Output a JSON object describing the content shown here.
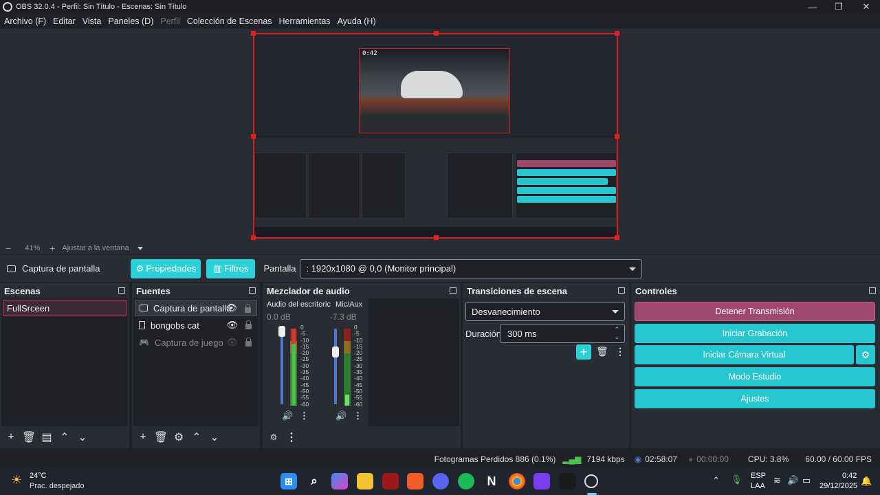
{
  "window": {
    "title": "OBS 32.0.4 - Perfil: Sin Título - Escenas: Sin Título",
    "minimize": "—",
    "maximize": "❐",
    "close": "✕"
  },
  "menu": [
    "Archivo (F)",
    "Editar",
    "Vista",
    "Paneles (D)",
    "Perfil",
    "Colección de Escenas",
    "Herramientas",
    "Ayuda (H)"
  ],
  "preview": {
    "time": "0:42",
    "zoom": "41%",
    "fit_label": "Ajustar a la ventana"
  },
  "source_bar": {
    "source_name": "Captura de pantalla",
    "properties_label": "Propiedades",
    "filters_label": "Filtros",
    "screen_label": "Pantalla",
    "screen_value": ": 1920x1080 @ 0,0 (Monitor principal)"
  },
  "scenes": {
    "title": "Escenas",
    "items": [
      "FullSrceen"
    ]
  },
  "sources": {
    "title": "Fuentes",
    "items": [
      {
        "label": "Captura de pantalla",
        "icon": "monitor-icon",
        "visible": true
      },
      {
        "label": "bongobs cat",
        "icon": "file-icon",
        "visible": true
      },
      {
        "label": "Captura de juego",
        "icon": "gamepad-icon",
        "visible": false
      }
    ]
  },
  "mixer": {
    "title": "Mezclador de audio",
    "channels": [
      {
        "name": "Audio del escritoric",
        "db": "0.0 dB",
        "level": 0.75
      },
      {
        "name": "Mic/Aux",
        "db": "-7.3 dB",
        "level": 0.1
      }
    ],
    "scale": [
      "0",
      "-5",
      "-10",
      "-15",
      "-20",
      "-25",
      "-30",
      "-35",
      "-40",
      "-45",
      "-50",
      "-55",
      "-60"
    ]
  },
  "transitions": {
    "title": "Transiciones de escena",
    "selected": "Desvanecimiento",
    "duration_label": "Duración",
    "duration_value": "300 ms"
  },
  "controls": {
    "title": "Controles",
    "stop_stream": "Detener Transmisión",
    "start_record": "Iniciar Grabación",
    "virtual_cam": "Iniciar Cámara Virtual",
    "studio_mode": "Modo Estudio",
    "settings": "Ajustes",
    "stop_color": "#a0486e",
    "accent": "#25c6d0"
  },
  "status": {
    "dropped": "Fotogramas Perdidos 886 (0.1%)",
    "bitrate": "7194 kbps",
    "stream_time": "02:58:07",
    "record_time": "00:00:00",
    "cpu": "CPU: 3.8%",
    "fps": "60.00 / 60.00 FPS"
  },
  "taskbar": {
    "weather_temp": "24°C",
    "weather_desc": "Prac. despejado",
    "lang1": "ESP",
    "lang2": "LAA",
    "time": "0:42",
    "date": "29/12/2025"
  }
}
